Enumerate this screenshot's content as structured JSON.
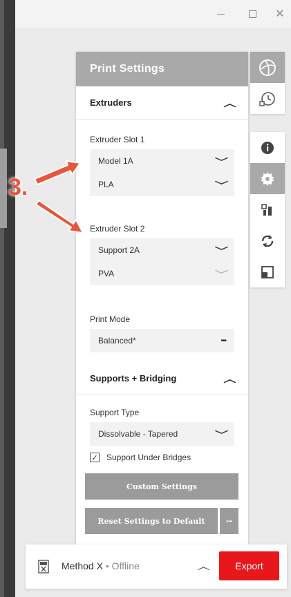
{
  "window": {
    "minimize": "—",
    "maximize": "☐",
    "close": "✕"
  },
  "panel": {
    "title": "Print Settings",
    "extruders": {
      "heading": "Extruders",
      "slot1": {
        "label": "Extruder Slot 1",
        "model": "Model 1A",
        "material": "PLA"
      },
      "slot2": {
        "label": "Extruder Slot 2",
        "model": "Support 2A",
        "material": "PVA"
      }
    },
    "print_mode": {
      "label": "Print Mode",
      "value": "Balanced*",
      "more": "•••"
    },
    "supports": {
      "heading": "Supports + Bridging",
      "support_type_label": "Support Type",
      "support_type_value": "Dissolvable - Tapered",
      "support_under_bridges": {
        "label": "Support Under Bridges",
        "checked": true
      }
    },
    "buttons": {
      "custom": "Custom Settings",
      "reset": "Reset Settings to Default",
      "reset_more": "•••"
    }
  },
  "side_tools": {
    "top": [
      "view-cube-icon",
      "timeline-icon"
    ],
    "bottom": [
      "info-icon",
      "settings-gear-icon",
      "arrange-icon",
      "rotate-icon",
      "scale-icon"
    ]
  },
  "status": {
    "printer": "Method X",
    "separator": " • ",
    "state": "Offline",
    "export_label": "Export"
  },
  "annotation": {
    "number": "3."
  },
  "colors": {
    "accent": "#e8171c",
    "annotation": "#e8563d",
    "panel_header": "#a9a9a9"
  }
}
